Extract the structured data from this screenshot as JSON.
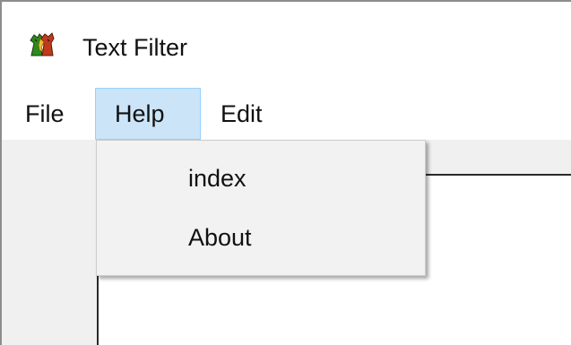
{
  "window": {
    "title": "Text Filter",
    "icon": "app-icon"
  },
  "menubar": {
    "items": [
      {
        "label": "File"
      },
      {
        "label": "Help"
      },
      {
        "label": "Edit"
      }
    ]
  },
  "help_menu": {
    "items": [
      {
        "label": "index"
      },
      {
        "label": "About"
      }
    ]
  },
  "colors": {
    "menu_highlight": "#cce4f7",
    "menu_highlight_border": "#99d1ff",
    "dropdown_background": "#f2f2f2"
  }
}
